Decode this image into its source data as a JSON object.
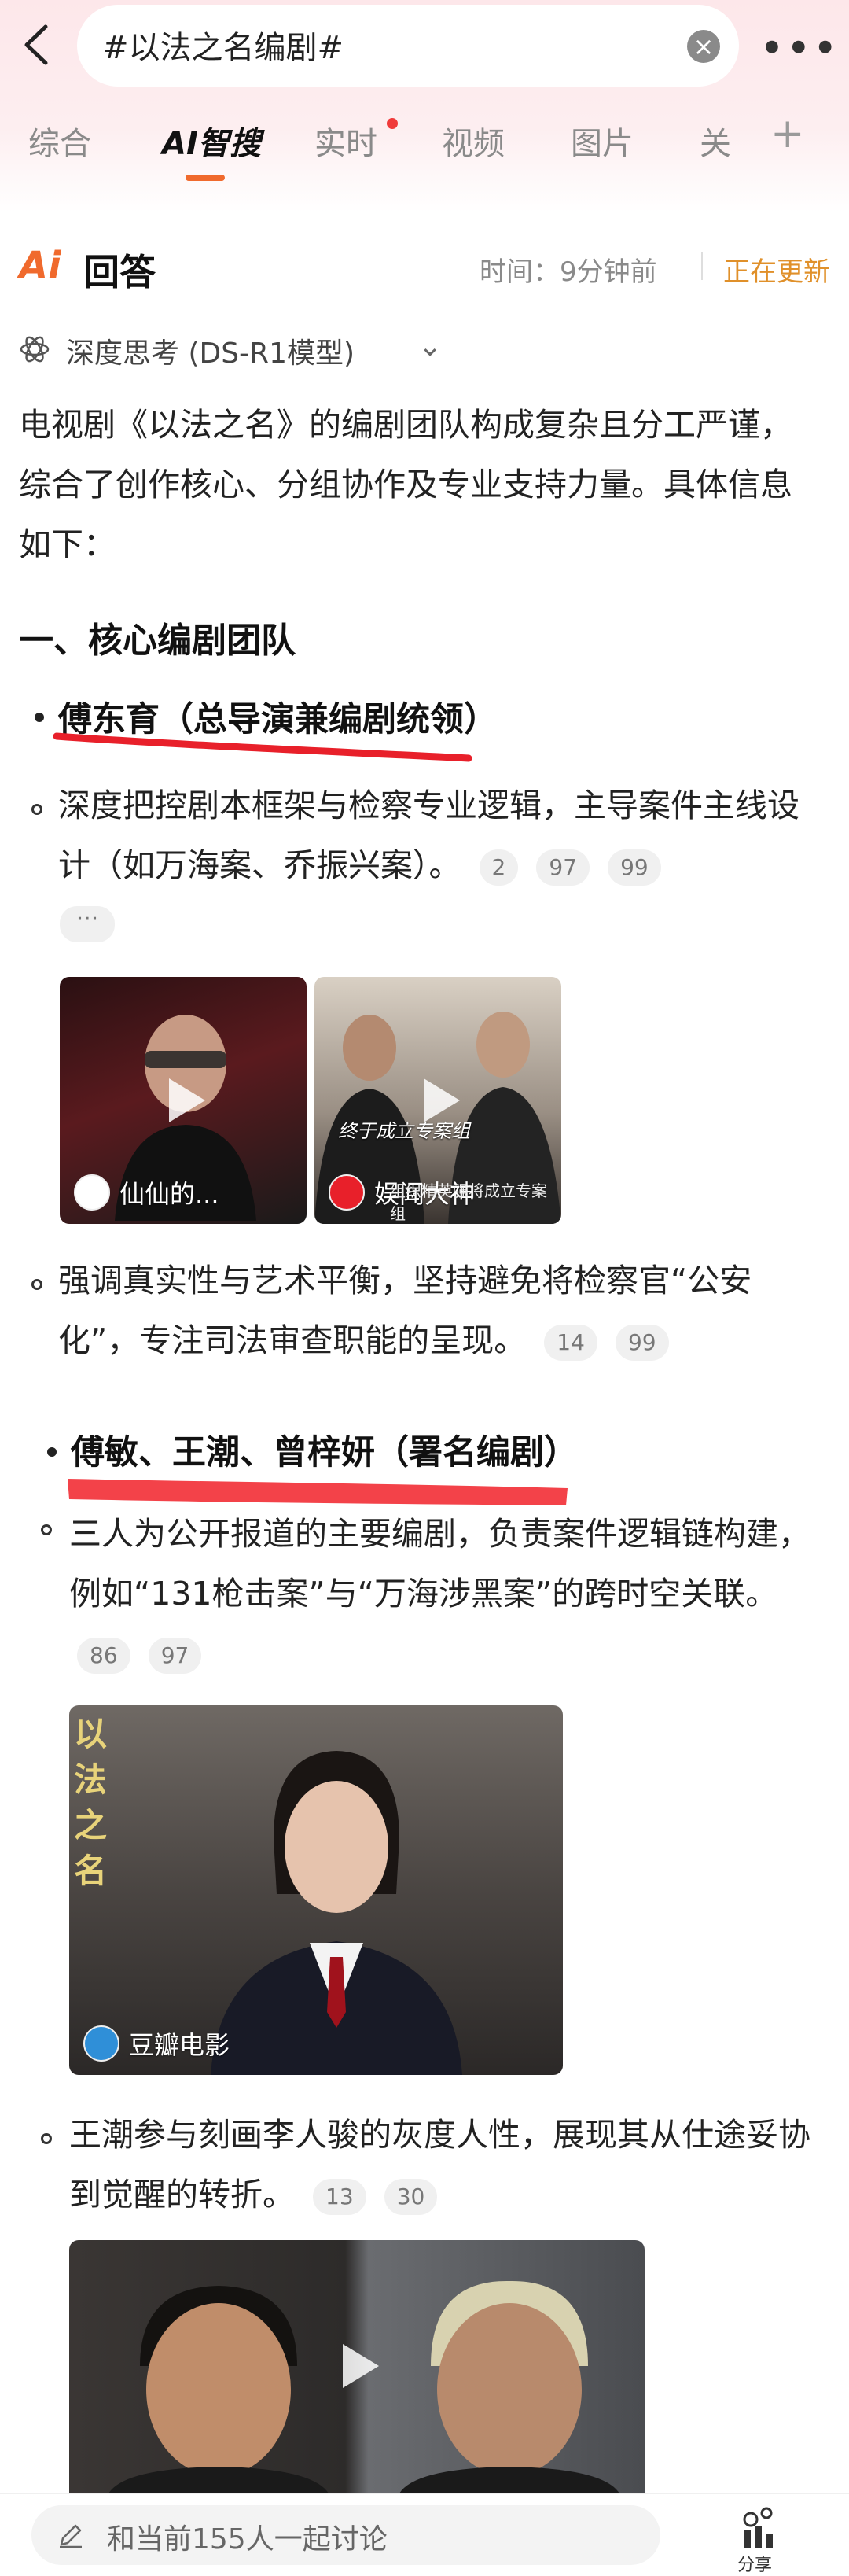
{
  "search": {
    "query": "#以法之名编剧#"
  },
  "tabs": [
    {
      "label": "综合"
    },
    {
      "label": "AI智搜"
    },
    {
      "label": "实时"
    },
    {
      "label": "视频"
    },
    {
      "label": "图片"
    },
    {
      "label": "关"
    }
  ],
  "answer": {
    "title": "回答",
    "time": "时间：9分钟前",
    "status": "正在更新",
    "model": "深度思考 (DS-R1模型)",
    "intro": "电视剧《以法之名》的编剧团队构成复杂且分工严谨，综合了创作核心、分组协作及专业支持力量。具体信息如下：",
    "section1": "一、核心编剧团队",
    "bullet1_title": "傅东育（总导演兼编剧统领）",
    "bullet1_sub1": "深度把控剧本框架与检察专业逻辑，主导案件主线设计（如万海案、乔振兴案）。",
    "bullet1_sub1_cites": [
      "2",
      "97",
      "99"
    ],
    "bullet1_sub2": "强调真实性与艺术平衡，坚持避免将检察官“公安化”，专注司法审查职能的呈现。",
    "bullet1_sub2_cites": [
      "14",
      "99"
    ],
    "bullet2_title": "傅敏、王潮、曾梓妍（署名编剧）",
    "bullet2_sub1": "三人为公开报道的主要编剧，负责案件逻辑链构建，例如“131枪击案”与“万海涉黑案”的跨时空关联。",
    "bullet2_sub1_cites": [
      "86",
      "97"
    ],
    "bullet2_sub2": "王潮参与刻画李人骏的灰度人性，展现其从仕途妥协到觉醒的转折。",
    "bullet2_sub2_cites": [
      "13",
      "30"
    ],
    "more_label": "···"
  },
  "media": {
    "video1_author": "仙仙的...",
    "video2_author": "娱闻大神",
    "video2_caption": "终于成立专案组",
    "video2_subtitle": "组织精英强将成立专案组",
    "image_author": "豆瓣电影",
    "image_watermark": "以法之名"
  },
  "bottom": {
    "discuss": "和当前155人一起讨论",
    "share": "分享"
  },
  "colors": {
    "accent": "#f06a2d",
    "updating": "#e0902a",
    "underline_red": "#e8202a"
  }
}
